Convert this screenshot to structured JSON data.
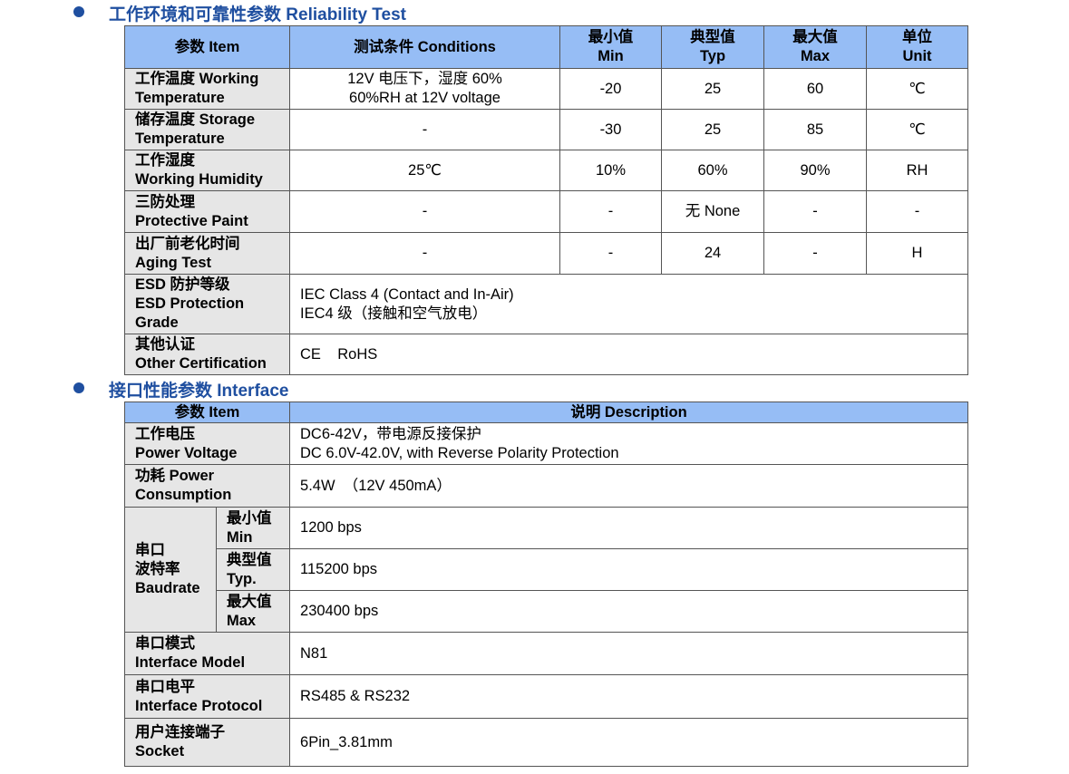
{
  "reliability": {
    "heading": "工作环境和可靠性参数  Reliability Test",
    "header": {
      "item": "参数  Item",
      "conditions": "测试条件  Conditions",
      "min_l1": "最小值",
      "min_l2": "Min",
      "typ_l1": "典型值",
      "typ_l2": "Typ",
      "max_l1": "最大值",
      "max_l2": "Max",
      "unit_l1": "单位",
      "unit_l2": "Unit"
    },
    "rows": [
      {
        "item_l1": "工作温度 Working",
        "item_l2": "Temperature",
        "cond_l1": "12V 电压下，湿度 60%",
        "cond_l2": "60%RH at 12V voltage",
        "min": "-20",
        "typ": "25",
        "max": "60",
        "unit": "℃"
      },
      {
        "item_l1": "储存温度  Storage",
        "item_l2": "Temperature",
        "cond_l1": "-",
        "cond_l2": "",
        "min": "-30",
        "typ": "25",
        "max": "85",
        "unit": "℃"
      },
      {
        "item_l1": "工作湿度",
        "item_l2": "Working Humidity",
        "cond_l1": "25℃",
        "cond_l2": "",
        "min": "10%",
        "typ": "60%",
        "max": "90%",
        "unit": "RH"
      },
      {
        "item_l1": "三防处理",
        "item_l2": "Protective Paint",
        "cond_l1": "-",
        "cond_l2": "",
        "min": "-",
        "typ": "无  None",
        "max": "-",
        "unit": "-"
      },
      {
        "item_l1": "出厂前老化时间",
        "item_l2": "Aging Test",
        "cond_l1": "-",
        "cond_l2": "",
        "min": "-",
        "typ": "24",
        "max": "-",
        "unit": "H"
      }
    ],
    "esd": {
      "item_l1": "ESD 防护等级",
      "item_l2": "ESD Protection",
      "item_l3": "Grade",
      "desc_l1": "IEC Class 4 (Contact and In-Air)",
      "desc_l2": "IEC4 级（接触和空气放电）"
    },
    "cert": {
      "item_l1": "其他认证",
      "item_l2": "Other Certification",
      "desc": "CE    RoHS"
    }
  },
  "interface": {
    "heading": "接口性能参数  Interface",
    "header": {
      "item": "参数  Item",
      "desc": "说明  Description"
    },
    "power_voltage": {
      "item_l1": "工作电压",
      "item_l2": "Power Voltage",
      "desc_l1": "DC6-42V，带电源反接保护",
      "desc_l2": "DC 6.0V-42.0V, with Reverse Polarity Protection"
    },
    "power_consumption": {
      "item_l1": "功耗 Power",
      "item_l2": "Consumption",
      "desc": "5.4W  （12V 450mA）"
    },
    "baudrate": {
      "item_l1": "串口",
      "item_l2": "波特率",
      "item_l3": "Baudrate",
      "min_l1": "最小值",
      "min_l2": "Min",
      "min_val": "1200 bps",
      "typ_l1": "典型值",
      "typ_l2": "Typ.",
      "typ_val": "115200 bps",
      "max_l1": "最大值",
      "max_l2": "Max",
      "max_val": "230400 bps"
    },
    "model": {
      "item_l1": "串口模式",
      "item_l2": "Interface Model",
      "desc": "N81"
    },
    "protocol": {
      "item_l1": "串口电平",
      "item_l2": "Interface Protocol",
      "desc": "RS485 & RS232"
    },
    "socket": {
      "item_l1": "用户连接端子",
      "item_l2": "Socket",
      "desc": "6Pin_3.81mm"
    }
  }
}
